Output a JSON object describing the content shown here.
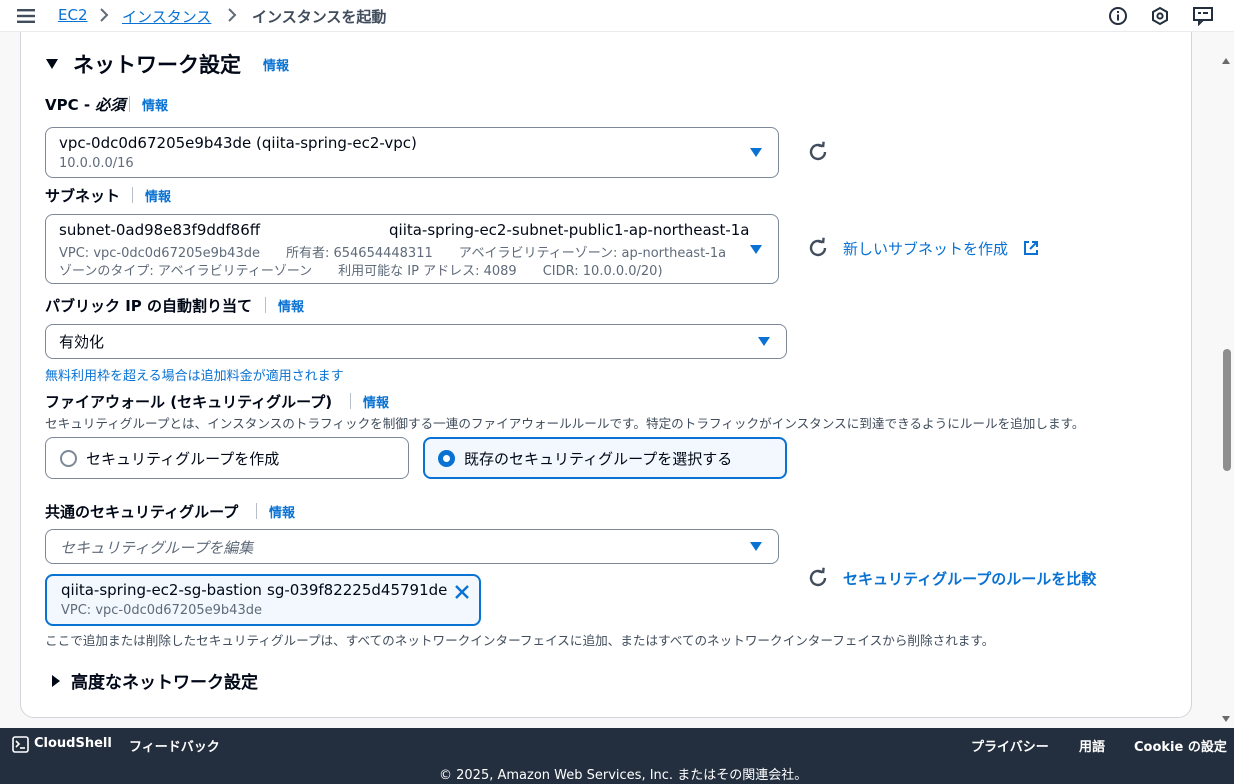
{
  "breadcrumb": {
    "items": [
      "EC2",
      "インスタンス"
    ],
    "current": "インスタンスを起動"
  },
  "section": {
    "title": "ネットワーク設定",
    "info": "情報"
  },
  "vpc": {
    "label": "VPC - ",
    "required": "必須",
    "info": "情報",
    "value": "vpc-0dc0d67205e9b43de (qiita-spring-ec2-vpc)",
    "sub": "10.0.0.0/16"
  },
  "subnet": {
    "label": "サブネット",
    "info": "情報",
    "id": "subnet-0ad98e83f9ddf86ff",
    "name": "qiita-spring-ec2-subnet-public1-ap-northeast-1a",
    "line2": "VPC: vpc-0dc0d67205e9b43de　　所有者: 654654448311　　アベイラビリティーゾーン: ap-northeast-1a",
    "line3": "ゾーンのタイプ: アベイラビリティーゾーン　　利用可能な IP アドレス: 4089　　CIDR: 10.0.0.0/20)",
    "create_link": "新しいサブネットを作成"
  },
  "public_ip": {
    "label": "パブリック IP の自動割り当て",
    "info": "情報",
    "value": "有効化",
    "note_pre": "無料利用枠を超える場合は",
    "note_link": "追加料金が適用されます"
  },
  "firewall": {
    "label": "ファイアウォール (セキュリティグループ)",
    "info": "情報",
    "desc": "セキュリティグループとは、インスタンスのトラフィックを制御する一連のファイアウォールルールです。特定のトラフィックがインスタンスに到達できるようにルールを追加します。",
    "option_create": "セキュリティグループを作成",
    "option_existing": "既存のセキュリティグループを選択する"
  },
  "common_sg": {
    "label": "共通のセキュリティグループ",
    "info": "情報",
    "placeholder": "セキュリティグループを編集",
    "token_name": "qiita-spring-ec2-sg-bastion",
    "token_id": "sg-039f82225d45791de",
    "token_sub": "VPC: vpc-0dc0d67205e9b43de",
    "compare_link": "セキュリティグループのルールを比較",
    "note": "ここで追加または削除したセキュリティグループは、すべてのネットワークインターフェイスに追加、またはすべてのネットワークインターフェイスから削除されます。"
  },
  "advanced": {
    "title": "高度なネットワーク設定"
  },
  "footer": {
    "cloudshell": "CloudShell",
    "feedback": "フィードバック",
    "privacy": "プライバシー",
    "terms": "用語",
    "cookie": "Cookie の設定",
    "copyright": "© 2025, Amazon Web Services, Inc. またはその関連会社。"
  },
  "colors": {
    "link": "#0972d3",
    "footer_bg": "#232f3e"
  }
}
